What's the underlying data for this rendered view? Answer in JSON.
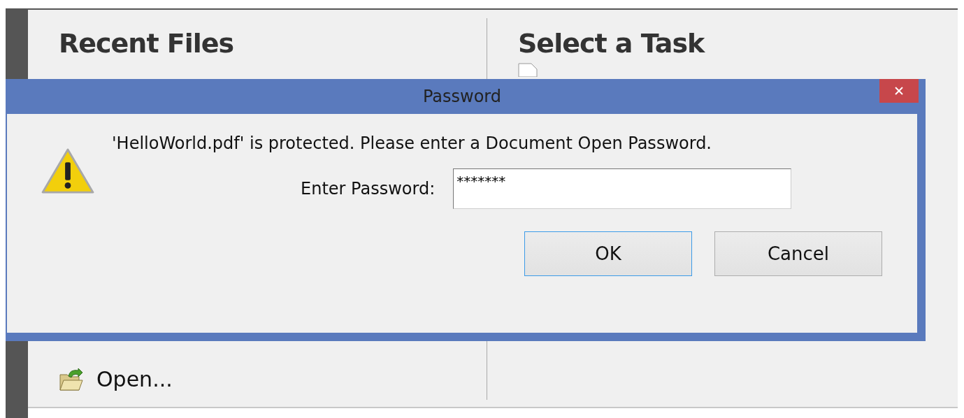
{
  "app": {
    "left_heading": "Recent Files",
    "right_heading": "Select a Task",
    "open_label": "Open..."
  },
  "dialog": {
    "title": "Password",
    "message": "'HelloWorld.pdf' is protected. Please enter a Document Open Password.",
    "field_label": "Enter Password:",
    "password_value": "*******",
    "buttons": [
      {
        "label": "OK",
        "focused": true
      },
      {
        "label": "Cancel",
        "focused": false
      }
    ]
  }
}
